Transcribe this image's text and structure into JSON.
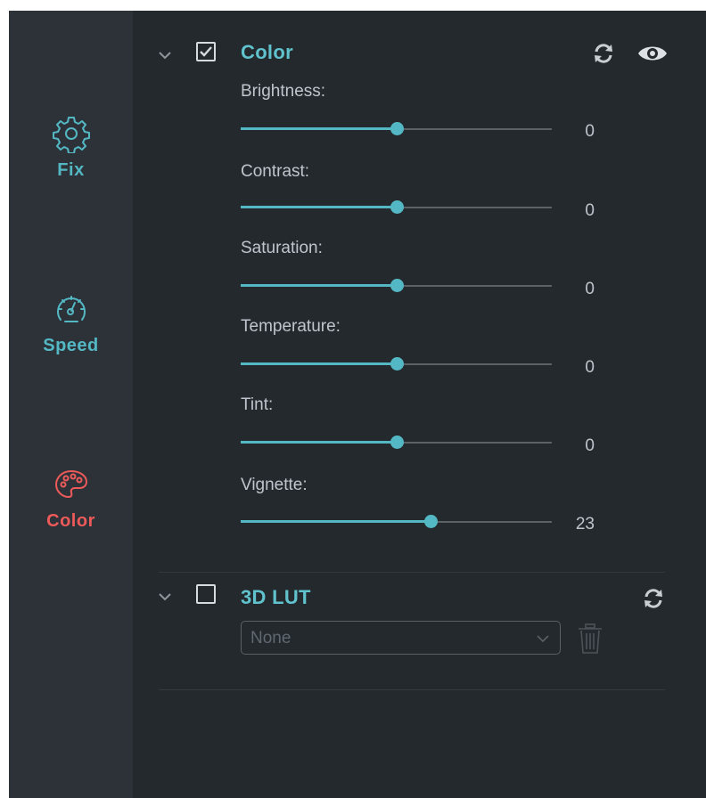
{
  "sidebar": {
    "items": [
      {
        "label": "Fix",
        "icon": "gear-icon",
        "color": "#53b8c4"
      },
      {
        "label": "Speed",
        "icon": "speedometer-icon",
        "color": "#53b8c4"
      },
      {
        "label": "Color",
        "icon": "palette-icon",
        "color": "#ec5a5a",
        "active": true
      }
    ]
  },
  "color_section": {
    "title": "Color",
    "enabled": true,
    "expanded": true,
    "reset_icon": "reset-icon",
    "preview_icon": "eye-icon",
    "params": [
      {
        "label": "Brightness:",
        "value": "0",
        "level": 0.5
      },
      {
        "label": "Contrast:",
        "value": "0",
        "level": 0.5
      },
      {
        "label": "Saturation:",
        "value": "0",
        "level": 0.5
      },
      {
        "label": "Temperature:",
        "value": "0",
        "level": 0.5
      },
      {
        "label": "Tint:",
        "value": "0",
        "level": 0.5
      },
      {
        "label": "Vignette:",
        "value": "23",
        "level": 0.61
      }
    ]
  },
  "lut_section": {
    "title": "3D LUT",
    "enabled": false,
    "expanded": true,
    "reset_icon": "reset-icon",
    "select_value": "None",
    "delete_icon": "trash-icon"
  },
  "colors": {
    "accent": "#53b8c4",
    "active_tab": "#ec5a5a",
    "panel_bg": "#24292e",
    "sidebar_bg": "#2d3238"
  }
}
